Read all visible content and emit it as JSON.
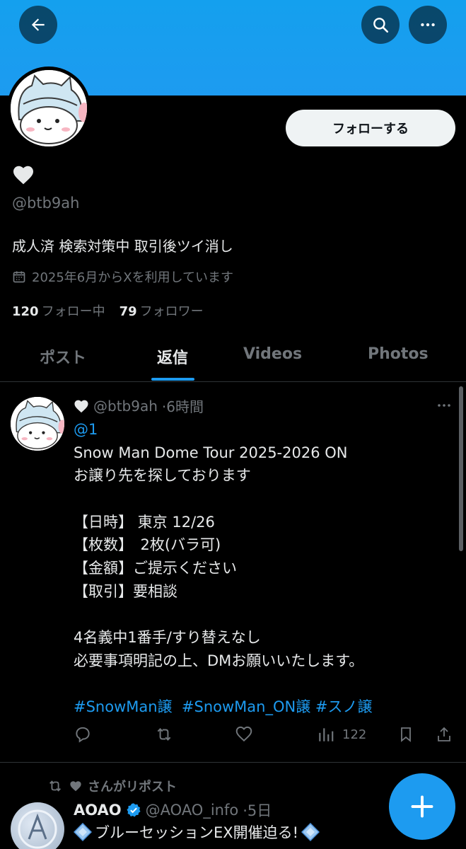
{
  "header": {
    "back_icon": "arrow-left-icon",
    "search_icon": "search-icon",
    "more_icon": "more-horizontal-icon",
    "banner_color": "#1d9bf0"
  },
  "profile": {
    "display_name_icon": "heart-icon",
    "handle": "@btb9ah",
    "bio": "成人済 検索対策中 取引後ツイ消し",
    "joined": "2025年6月からXを利用しています",
    "following_count": "120",
    "following_label": "フォロー中",
    "followers_count": "79",
    "followers_label": "フォロワー",
    "follow_button": "フォローする"
  },
  "tabs": [
    {
      "label": "ポスト",
      "active": false
    },
    {
      "label": "返信",
      "active": true
    },
    {
      "label": "Videos",
      "active": false
    },
    {
      "label": "Photos",
      "active": false
    }
  ],
  "post": {
    "handle": "@btb9ah",
    "time": "·6時間",
    "reply_to": "@1",
    "lines": [
      "Snow Man Dome Tour 2025-2026 ON",
      "お譲り先を探しております",
      "",
      "【日時】 東京 12/26",
      "【枚数】　2枚(バラ可)",
      "【金額】ご提示ください",
      "【取引】要相談",
      "",
      "4名義中1番手/すり替えなし",
      "必要事項明記の上、DMお願いいたします。",
      ""
    ],
    "hashtags": "#SnowMan譲  #SnowMan_ON譲 #スノ譲",
    "views": "122"
  },
  "repost": {
    "label": "さんがリポスト",
    "name": "AOAO",
    "handle": "@AOAO_info",
    "time": "·5日",
    "text": "ブルーセッションEX開催迫る!"
  },
  "colors": {
    "accent": "#1d9bf0",
    "muted": "#71767b",
    "text": "#e7e9ea",
    "background": "#000000"
  }
}
